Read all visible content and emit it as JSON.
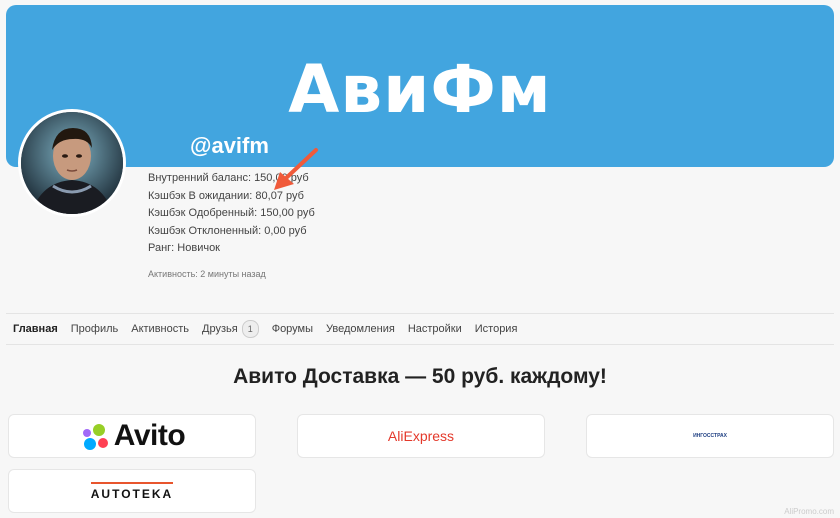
{
  "cover": {
    "title": "АвиФм"
  },
  "profile": {
    "username": "@avifm",
    "stats": [
      "Внутренний баланс: 150,00 руб",
      "Кэшбэк В ожидании: 80,07 руб",
      "Кэшбэк Одобренный: 150,00 руб",
      "Кэшбэк Отклоненный: 0,00 руб",
      "Ранг: Новичок"
    ],
    "activity": "Активность: 2 минуты назад"
  },
  "tabs": [
    {
      "label": "Главная",
      "active": true
    },
    {
      "label": "Профиль"
    },
    {
      "label": "Активность"
    },
    {
      "label": "Друзья",
      "badge": "1"
    },
    {
      "label": "Форумы"
    },
    {
      "label": "Уведомления"
    },
    {
      "label": "Настройки"
    },
    {
      "label": "История"
    }
  ],
  "headline": "Авито Доставка — 50 руб. каждому!",
  "stores": {
    "avito": "Avito",
    "aliexpress": "AliExpress",
    "ingosstrakh": "ИНГОССТРАХ",
    "autoteka": "AUTOTEKA"
  },
  "watermark": "AliPromo.com",
  "colors": {
    "cover": "#42a5df",
    "arrow": "#f05a3a",
    "aliexpress": "#e4392b",
    "autoteka_accent": "#e8552d"
  }
}
